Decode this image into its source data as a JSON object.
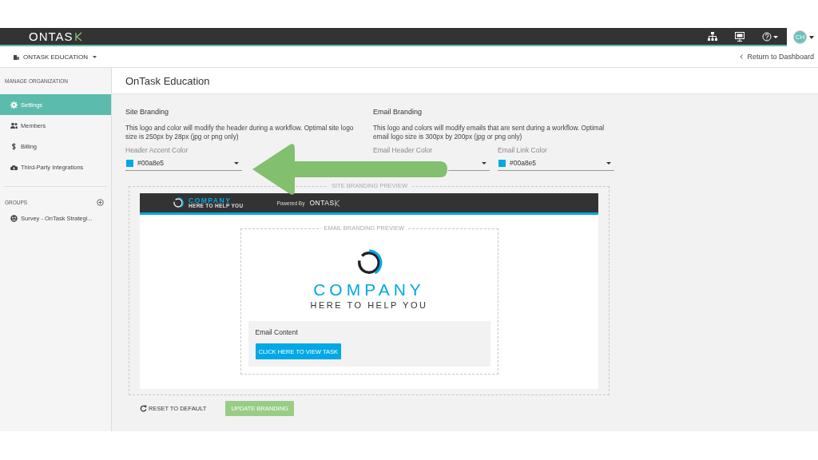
{
  "top_bar": {
    "logo": "ONTAS",
    "avatar_initials": "CH"
  },
  "sub_bar": {
    "org": "ONTASK EDUCATION",
    "back_link": "Return to Dashboard"
  },
  "sidebar": {
    "section": "MANAGE ORGANIZATION",
    "items": [
      {
        "label": "Settings",
        "kind": "gear",
        "selected": true
      },
      {
        "label": "Members",
        "kind": "people",
        "selected": false
      },
      {
        "label": "Billing",
        "kind": "dollar",
        "selected": false
      },
      {
        "label": "Third-Party Integrations",
        "kind": "cloud",
        "selected": false
      }
    ],
    "groups_heading": "GROUPS",
    "groups": [
      {
        "label": "Survey - OnTask Strategi..."
      }
    ]
  },
  "main": {
    "title": "OnTask Education",
    "site_branding": {
      "heading": "Site Branding",
      "description": "This logo and color will modify the header during a workflow. Optimal site logo size is 250px by 28px (jpg or png only)",
      "fields": [
        {
          "label": "Header Accent Color",
          "value": "#00a8e5",
          "color": "#00a8e5"
        }
      ]
    },
    "email_branding": {
      "heading": "Email Branding",
      "description": "This logo and colors will modify emails that are sent during a workflow. Optimal email logo size is 300px by 200px (jpg or png only)",
      "fields": [
        {
          "label": "Email Header Color"
        },
        {
          "label": "Email Link Color",
          "value": "#00a8e5",
          "color": "#00a8e5"
        }
      ]
    },
    "preview": {
      "legend": "SITE BRANDING PREVIEW",
      "company": "COMPANY",
      "tagline": "HERE TO HELP YOU",
      "powered_by": "Powered By",
      "powered_logo": "ONTAS",
      "email": {
        "legend": "EMAIL BRANDING PREVIEW",
        "company": "COMPANY",
        "tagline": "HERE TO HELP YOU",
        "content": "Email Content",
        "button": "CLICK HERE TO VIEW TASK"
      }
    },
    "actions": {
      "reset": "RESET TO DEFAULT",
      "update": "UPDATE BRANDING"
    }
  }
}
